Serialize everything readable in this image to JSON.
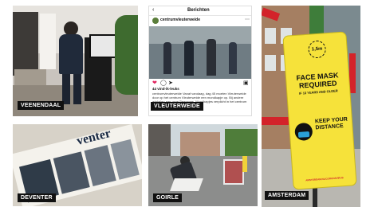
{
  "tiles": {
    "veenendaal": {
      "caption": "VEENENDAAL"
    },
    "vleuterweide": {
      "caption": "VLEUTERWEIDE",
      "post_header": "Berichten",
      "account": "centrumvleuterweide",
      "likes": "44 vind-ik-leuks",
      "post_text": "centrumvleuterweide Vanaf vandaag, dag 45 moeten Vleuterweide door op het centrum Vleuterweide een mondkapje op. Bij andere winkelen aan onze Bewoners. Mondkapjes verplicht in het centrum"
    },
    "amsterdam": {
      "caption": "AMSTERDAM",
      "sign_distance": "1,5m",
      "sign_title": "FACE MASK REQUIRED",
      "sign_subtitle": "IF 13 YEARS AND OLDER",
      "sign_keep": "KEEP YOUR DISTANCE",
      "sign_footer": "AMSTERDAM.NL/CORONAVIRUS"
    },
    "deventer": {
      "caption": "DEVENTER",
      "masthead": "venter"
    },
    "gorle": {
      "caption": "GOIRLE"
    }
  },
  "colors": {
    "sign_yellow": "#f6e23a",
    "caption_bg": "#111111",
    "sign_red": "#d3232a"
  }
}
